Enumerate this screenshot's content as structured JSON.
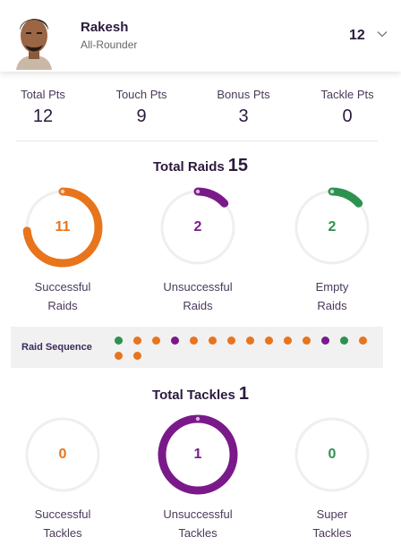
{
  "player": {
    "name": "Rakesh",
    "role": "All-Rounder",
    "number": "12"
  },
  "points": [
    {
      "label": "Total Pts",
      "value": "12"
    },
    {
      "label": "Touch Pts",
      "value": "9"
    },
    {
      "label": "Bonus Pts",
      "value": "3"
    },
    {
      "label": "Tackle Pts",
      "value": "0"
    }
  ],
  "raids": {
    "title": "Total Raids",
    "total": "15",
    "rings": [
      {
        "value": "11",
        "label_line1": "Successful",
        "label_line2": "Raids",
        "color": "#e8741c",
        "fraction": 0.733
      },
      {
        "value": "2",
        "label_line1": "Unsuccessful",
        "label_line2": "Raids",
        "color": "#7a1a8a",
        "fraction": 0.133
      },
      {
        "value": "2",
        "label_line1": "Empty",
        "label_line2": "Raids",
        "color": "#2e9150",
        "fraction": 0.133
      }
    ],
    "sequence_label": "Raid Sequence",
    "sequence": [
      "green",
      "orange",
      "orange",
      "purple",
      "orange",
      "orange",
      "orange",
      "orange",
      "orange",
      "orange",
      "orange",
      "purple",
      "green",
      "orange",
      "orange",
      "orange"
    ]
  },
  "tackles": {
    "title": "Total Tackles",
    "total": "1",
    "rings": [
      {
        "value": "0",
        "label_line1": "Successful",
        "label_line2": "Tackles",
        "color": "#e8741c",
        "fraction": 0
      },
      {
        "value": "1",
        "label_line1": "Unsuccessful",
        "label_line2": "Tackles",
        "color": "#7a1a8a",
        "fraction": 1
      },
      {
        "value": "0",
        "label_line1": "Super",
        "label_line2": "Tackles",
        "color": "#2e9150",
        "fraction": 0
      }
    ]
  },
  "colors": {
    "orange": "#e8741c",
    "purple": "#7a1a8a",
    "green": "#2e9150",
    "title": "#2c1a3d"
  },
  "icons": {
    "dropdown": "chevron-down-icon"
  }
}
